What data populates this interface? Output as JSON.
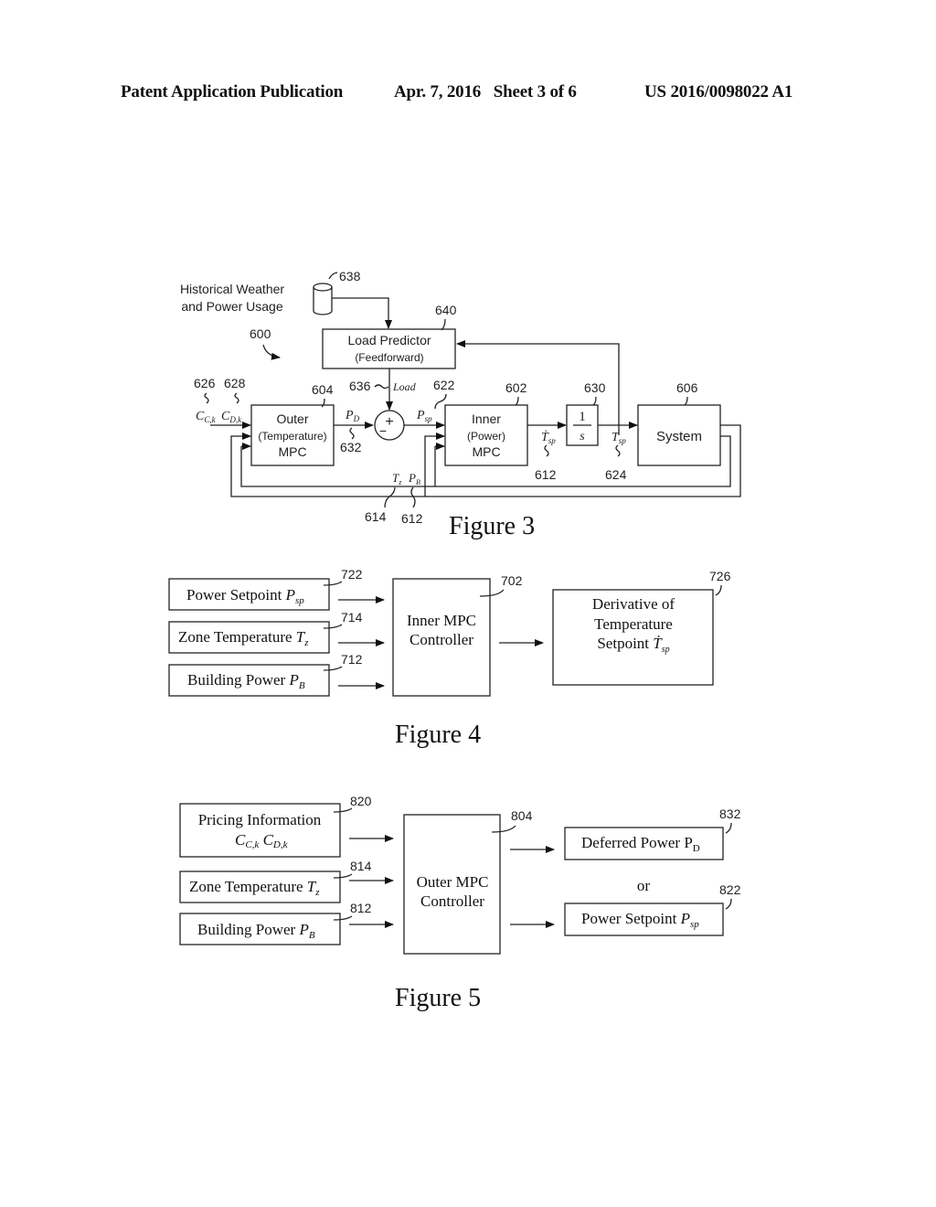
{
  "header": {
    "publication": "Patent Application Publication",
    "date_sheet": "Apr. 7, 2016   Sheet 3 of 6",
    "number": "US 2016/0098022 A1"
  },
  "fig3": {
    "caption": "Figure 3",
    "ref_600": "600",
    "historical_label_1": "Historical Weather",
    "historical_label_2": "and Power Usage",
    "ref_638": "638",
    "ref_640": "640",
    "load_predictor_1": "Load Predictor",
    "load_predictor_2": "(Feedforward)",
    "ref_626": "626",
    "ref_628": "628",
    "cck": "C",
    "cck_sub": "C,k",
    "cdk": "C",
    "cdk_sub": "D,k",
    "ref_604": "604",
    "outer_1": "Outer",
    "outer_2": "(Temperature)",
    "outer_3": "MPC",
    "pd": "P",
    "pd_sub": "D",
    "ref_632": "632",
    "ref_636": "636",
    "load": "Load",
    "plus": "+",
    "minus": "−",
    "psp": "P",
    "psp_sub": "sp",
    "ref_622": "622",
    "ref_602": "602",
    "inner_1": "Inner",
    "inner_2": "(Power)",
    "inner_3": "MPC",
    "tdot": "Ṫ",
    "tdot_sub": "sp",
    "ref_612a": "612",
    "ref_630": "630",
    "integ_num": "1",
    "integ_den": "s",
    "tsp": "T",
    "tsp_sub": "sp",
    "ref_624": "624",
    "ref_606": "606",
    "system": "System",
    "tz": "T",
    "tz_sub": "z",
    "pb": "P",
    "pb_sub": "B",
    "ref_614": "614",
    "ref_612b": "612"
  },
  "fig4": {
    "caption": "Figure 4",
    "inputs": [
      {
        "ref": "722",
        "label": "Power Setpoint ",
        "sym": "P",
        "sub": "sp"
      },
      {
        "ref": "714",
        "label": "Zone Temperature ",
        "sym": "T",
        "sub": "z"
      },
      {
        "ref": "712",
        "label": "Building Power ",
        "sym": "P",
        "sub": "B"
      }
    ],
    "controller_ref": "702",
    "controller_1": "Inner MPC",
    "controller_2": "Controller",
    "output_ref": "726",
    "output_1": "Derivative of",
    "output_2": "Temperature",
    "output_3": "Setpoint ",
    "output_sym": "Ṫ",
    "output_sub": "sp"
  },
  "fig5": {
    "caption": "Figure 5",
    "pricing_ref": "820",
    "pricing_1": "Pricing Information",
    "pricing_c1": "C",
    "pricing_c1_sub": "C,k",
    "pricing_c2": "C",
    "pricing_c2_sub": "D,k",
    "zone_ref": "814",
    "zone_label": "Zone Temperature ",
    "zone_sym": "T",
    "zone_sub": "z",
    "bp_ref": "812",
    "bp_label": "Building Power ",
    "bp_sym": "P",
    "bp_sub": "B",
    "controller_ref": "804",
    "controller_1": "Outer MPC",
    "controller_2": "Controller",
    "out1_ref": "832",
    "out1_label": "Deferred Power P",
    "out1_sub": "D",
    "or": "or",
    "out2_ref": "822",
    "out2_label": "Power Setpoint ",
    "out2_sym": "P",
    "out2_sub": "sp"
  }
}
